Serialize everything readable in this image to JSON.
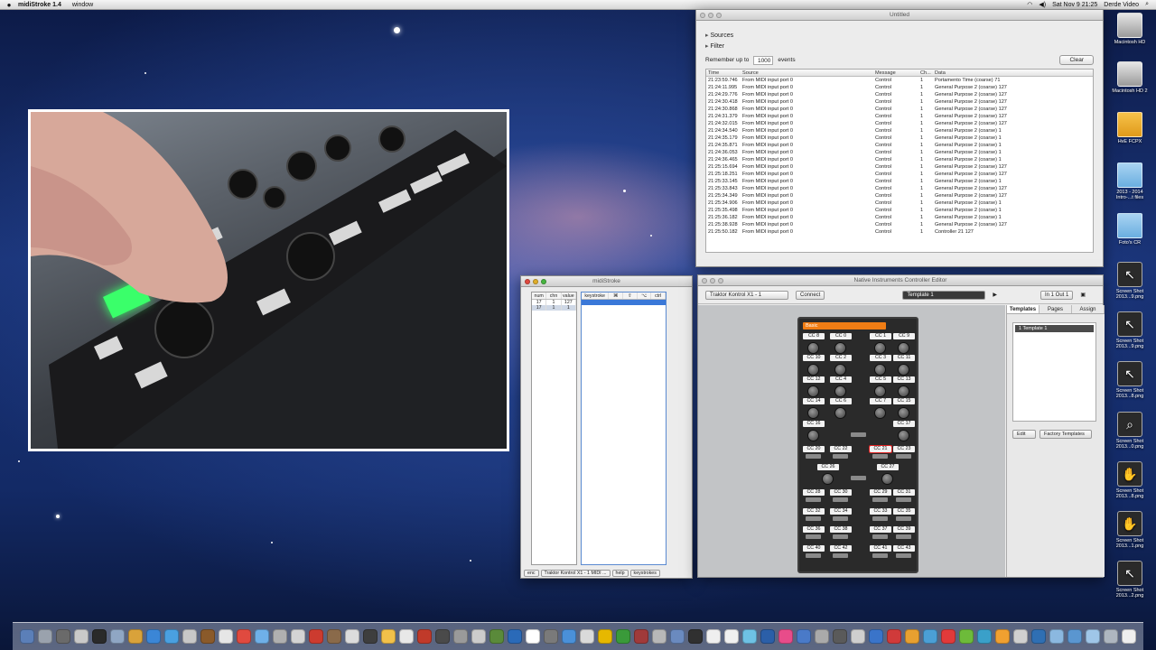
{
  "menubar": {
    "app_name": "midiStroke 1.4",
    "menu_items": [
      "window"
    ],
    "clock": "Sat Nov 9  21:25",
    "user": "Derde Video"
  },
  "midi_monitor": {
    "title": "Untitled",
    "sources_label": "Sources",
    "filter_label": "Filter",
    "remember_prefix": "Remember up to",
    "remember_value": "1000",
    "remember_suffix": "events",
    "clear_label": "Clear",
    "columns": [
      "Time",
      "Source",
      "Message",
      "Ch...",
      "Data"
    ],
    "rows": [
      [
        "21:23:59.746",
        "From MIDI input port 0",
        "Control",
        "1",
        "Portamento Time (coarse) 71"
      ],
      [
        "21:24:11.995",
        "From MIDI input port 0",
        "Control",
        "1",
        "General Purpose 2 (coarse)     127"
      ],
      [
        "21:24:29.776",
        "From MIDI input port 0",
        "Control",
        "1",
        "General Purpose 2 (coarse)     127"
      ],
      [
        "21:24:30.418",
        "From MIDI input port 0",
        "Control",
        "1",
        "General Purpose 2 (coarse)     127"
      ],
      [
        "21:24:30.868",
        "From MIDI input port 0",
        "Control",
        "1",
        "General Purpose 2 (coarse)     127"
      ],
      [
        "21:24:31.379",
        "From MIDI input port 0",
        "Control",
        "1",
        "General Purpose 2 (coarse)     127"
      ],
      [
        "21:24:32.015",
        "From MIDI input port 0",
        "Control",
        "1",
        "General Purpose 2 (coarse)     127"
      ],
      [
        "21:24:34.540",
        "From MIDI input port 0",
        "Control",
        "1",
        "General Purpose 2 (coarse)     1"
      ],
      [
        "21:24:35.179",
        "From MIDI input port 0",
        "Control",
        "1",
        "General Purpose 2 (coarse)     1"
      ],
      [
        "21:24:35.871",
        "From MIDI input port 0",
        "Control",
        "1",
        "General Purpose 2 (coarse)     1"
      ],
      [
        "21:24:36.053",
        "From MIDI input port 0",
        "Control",
        "1",
        "General Purpose 2 (coarse)     1"
      ],
      [
        "21:24:36.465",
        "From MIDI input port 0",
        "Control",
        "1",
        "General Purpose 2 (coarse)     1"
      ],
      [
        "21:25:15.694",
        "From MIDI input port 0",
        "Control",
        "1",
        "General Purpose 2 (coarse)     127"
      ],
      [
        "21:25:18.251",
        "From MIDI input port 0",
        "Control",
        "1",
        "General Purpose 2 (coarse)     127"
      ],
      [
        "21:25:33.145",
        "From MIDI input port 0",
        "Control",
        "1",
        "General Purpose 2 (coarse)     1"
      ],
      [
        "21:25:33.843",
        "From MIDI input port 0",
        "Control",
        "1",
        "General Purpose 2 (coarse)     127"
      ],
      [
        "21:25:34.349",
        "From MIDI input port 0",
        "Control",
        "1",
        "General Purpose 2 (coarse)     127"
      ],
      [
        "21:25:34.906",
        "From MIDI input port 0",
        "Control",
        "1",
        "General Purpose 2 (coarse)     1"
      ],
      [
        "21:25:35.498",
        "From MIDI input port 0",
        "Control",
        "1",
        "General Purpose 2 (coarse)     1"
      ],
      [
        "21:25:36.182",
        "From MIDI input port 0",
        "Control",
        "1",
        "General Purpose 2 (coarse)     1"
      ],
      [
        "21:25:38.928",
        "From MIDI input port 0",
        "Control",
        "1",
        "General Purpose 2 (coarse)     127"
      ],
      [
        "21:25:50.182",
        "From MIDI input port 0",
        "Control",
        "1",
        "Controller 21     127"
      ]
    ]
  },
  "midistroke": {
    "title": "midiStroke",
    "left_columns": [
      "num",
      "chn",
      "value"
    ],
    "left_rows": [
      [
        "17",
        "1",
        "127"
      ],
      [
        "17",
        "1",
        "1"
      ]
    ],
    "right_columns": [
      "keystroke",
      "⌘",
      "⇧",
      "⌥",
      "ctrl"
    ],
    "footer": [
      "enc",
      "Traktor Kontrol X1 - 1 MIDI ...",
      "help",
      "keystrokes"
    ]
  },
  "ni_editor": {
    "title": "Native Instruments Controller Editor",
    "device": "Traktor Kontrol X1 - 1",
    "connect_label": "Connect",
    "template": "Template 1",
    "in_out": "In 1  Out 1",
    "device_page": "Basic",
    "cc_labels": [
      "CC 8",
      "CC 0",
      "CC 1",
      "CC 9",
      "CC 10",
      "CC 2",
      "CC 3",
      "CC 11",
      "CC 12",
      "CC 4",
      "CC 5",
      "CC 13",
      "CC 14",
      "CC 6",
      "CC 7",
      "CC 15",
      "CC 16",
      "CC 17",
      "CC 20",
      "CC 22",
      "CC 21",
      "CC 23",
      "CC 26",
      "CC 27",
      "CC 28",
      "CC 30",
      "CC 29",
      "CC 31",
      "CC 32",
      "CC 34",
      "CC 33",
      "CC 35",
      "CC 36",
      "CC 38",
      "CC 37",
      "CC 39",
      "CC 40",
      "CC 42",
      "CC 41",
      "CC 43"
    ],
    "selected_cc": "CC 21",
    "tabs": [
      "Templates",
      "Pages",
      "Assign"
    ],
    "active_tab": "Templates",
    "template_list": [
      "1    Template 1"
    ],
    "edit_label": "Edit",
    "factory_label": "Factory Templates"
  },
  "desktop_icons": [
    {
      "label": "Macintosh HD",
      "icon": "hard-drive-icon"
    },
    {
      "label": "Macintosh HD 2",
      "icon": "hard-drive-icon"
    },
    {
      "label": "HvE FCPX",
      "icon": "folder-icon"
    },
    {
      "label": "2013 - 2014 Intro-...t files",
      "icon": "folder-icon"
    },
    {
      "label": "Foto's CR",
      "icon": "folder-icon"
    },
    {
      "label": "Screen Shot 2013...9.png",
      "icon": "cursor-screenshot-icon"
    },
    {
      "label": "Screen Shot 2013...9.png",
      "icon": "cursor-screenshot-icon"
    },
    {
      "label": "Screen Shot 2013...8.png",
      "icon": "cursor-screenshot-icon"
    },
    {
      "label": "Screen Shot 2013...0.png",
      "icon": "magnifier-screenshot-icon"
    },
    {
      "label": "Screen Shot 2013...8.png",
      "icon": "hand-screenshot-icon"
    },
    {
      "label": "Screen Shot 2013...1.png",
      "icon": "hand-screenshot-icon"
    },
    {
      "label": "Screen Shot 2013...2.png",
      "icon": "cursor-screenshot-icon"
    }
  ],
  "dock": {
    "colors": [
      "#5b7fb8",
      "#9aa2ad",
      "#6a6a6a",
      "#c9c9c9",
      "#2a2a2a",
      "#8fa6c4",
      "#d9a23a",
      "#3b86d6",
      "#4aa0e0",
      "#c8c8c8",
      "#8a5a2a",
      "#e6e6e6",
      "#e04a3f",
      "#6fb0e8",
      "#b0b0b0",
      "#d4d4d4",
      "#cc3b2f",
      "#8a6a4a",
      "#dcdcdc",
      "#3e3e3e",
      "#f2c14a",
      "#e8e8e8",
      "#c03a2a",
      "#4a4a4a",
      "#9a9a9a",
      "#cccccc",
      "#5a8a3a",
      "#2a6ab8",
      "#ffffff",
      "#7a7a7a",
      "#4a90d9",
      "#dadada",
      "#e6b800",
      "#3a9a3a",
      "#a03a3a",
      "#b8b8b8",
      "#6a8abf",
      "#303030",
      "#efefef",
      "#f0f0f0",
      "#6ec1e4",
      "#2b5fa8",
      "#e84c8a",
      "#4a7ac8",
      "#aaaaaa",
      "#5a5a5a",
      "#cfcfcf",
      "#3a74c9",
      "#d03a3a",
      "#e8a030",
      "#4b9fd6",
      "#e23a3a",
      "#6dbb3a",
      "#3aa0c9",
      "#f0a030",
      "#d0d0d0",
      "#2f6fb3",
      "#8bb8e0",
      "#5a96d0",
      "#9fc6e8",
      "#aeb6c0",
      "#eeeeee"
    ]
  }
}
